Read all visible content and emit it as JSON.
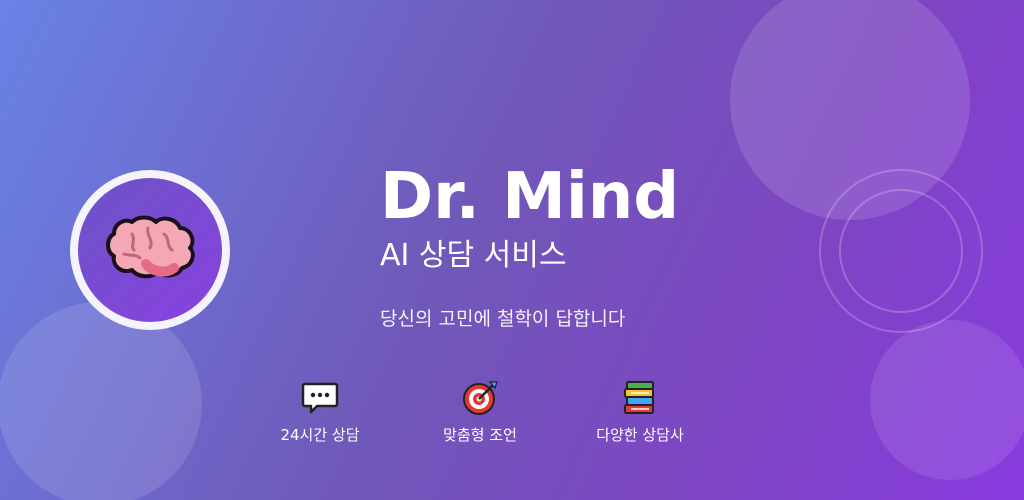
{
  "hero": {
    "title": "Dr. Mind",
    "subtitle": "AI 상담 서비스",
    "tagline": "당신의 고민에 철학이 답합니다"
  },
  "avatar": {
    "icon": "brain-icon"
  },
  "features": [
    {
      "icon": "speech-bubble-icon",
      "label": "24시간 상담"
    },
    {
      "icon": "target-icon",
      "label": "맞춤형 조언"
    },
    {
      "icon": "books-icon",
      "label": "다양한 상담사"
    }
  ],
  "colors": {
    "gradient_start": "#6a82e6",
    "gradient_mid": "#7058b8",
    "gradient_end": "#8a3be0",
    "text": "#ffffff"
  }
}
